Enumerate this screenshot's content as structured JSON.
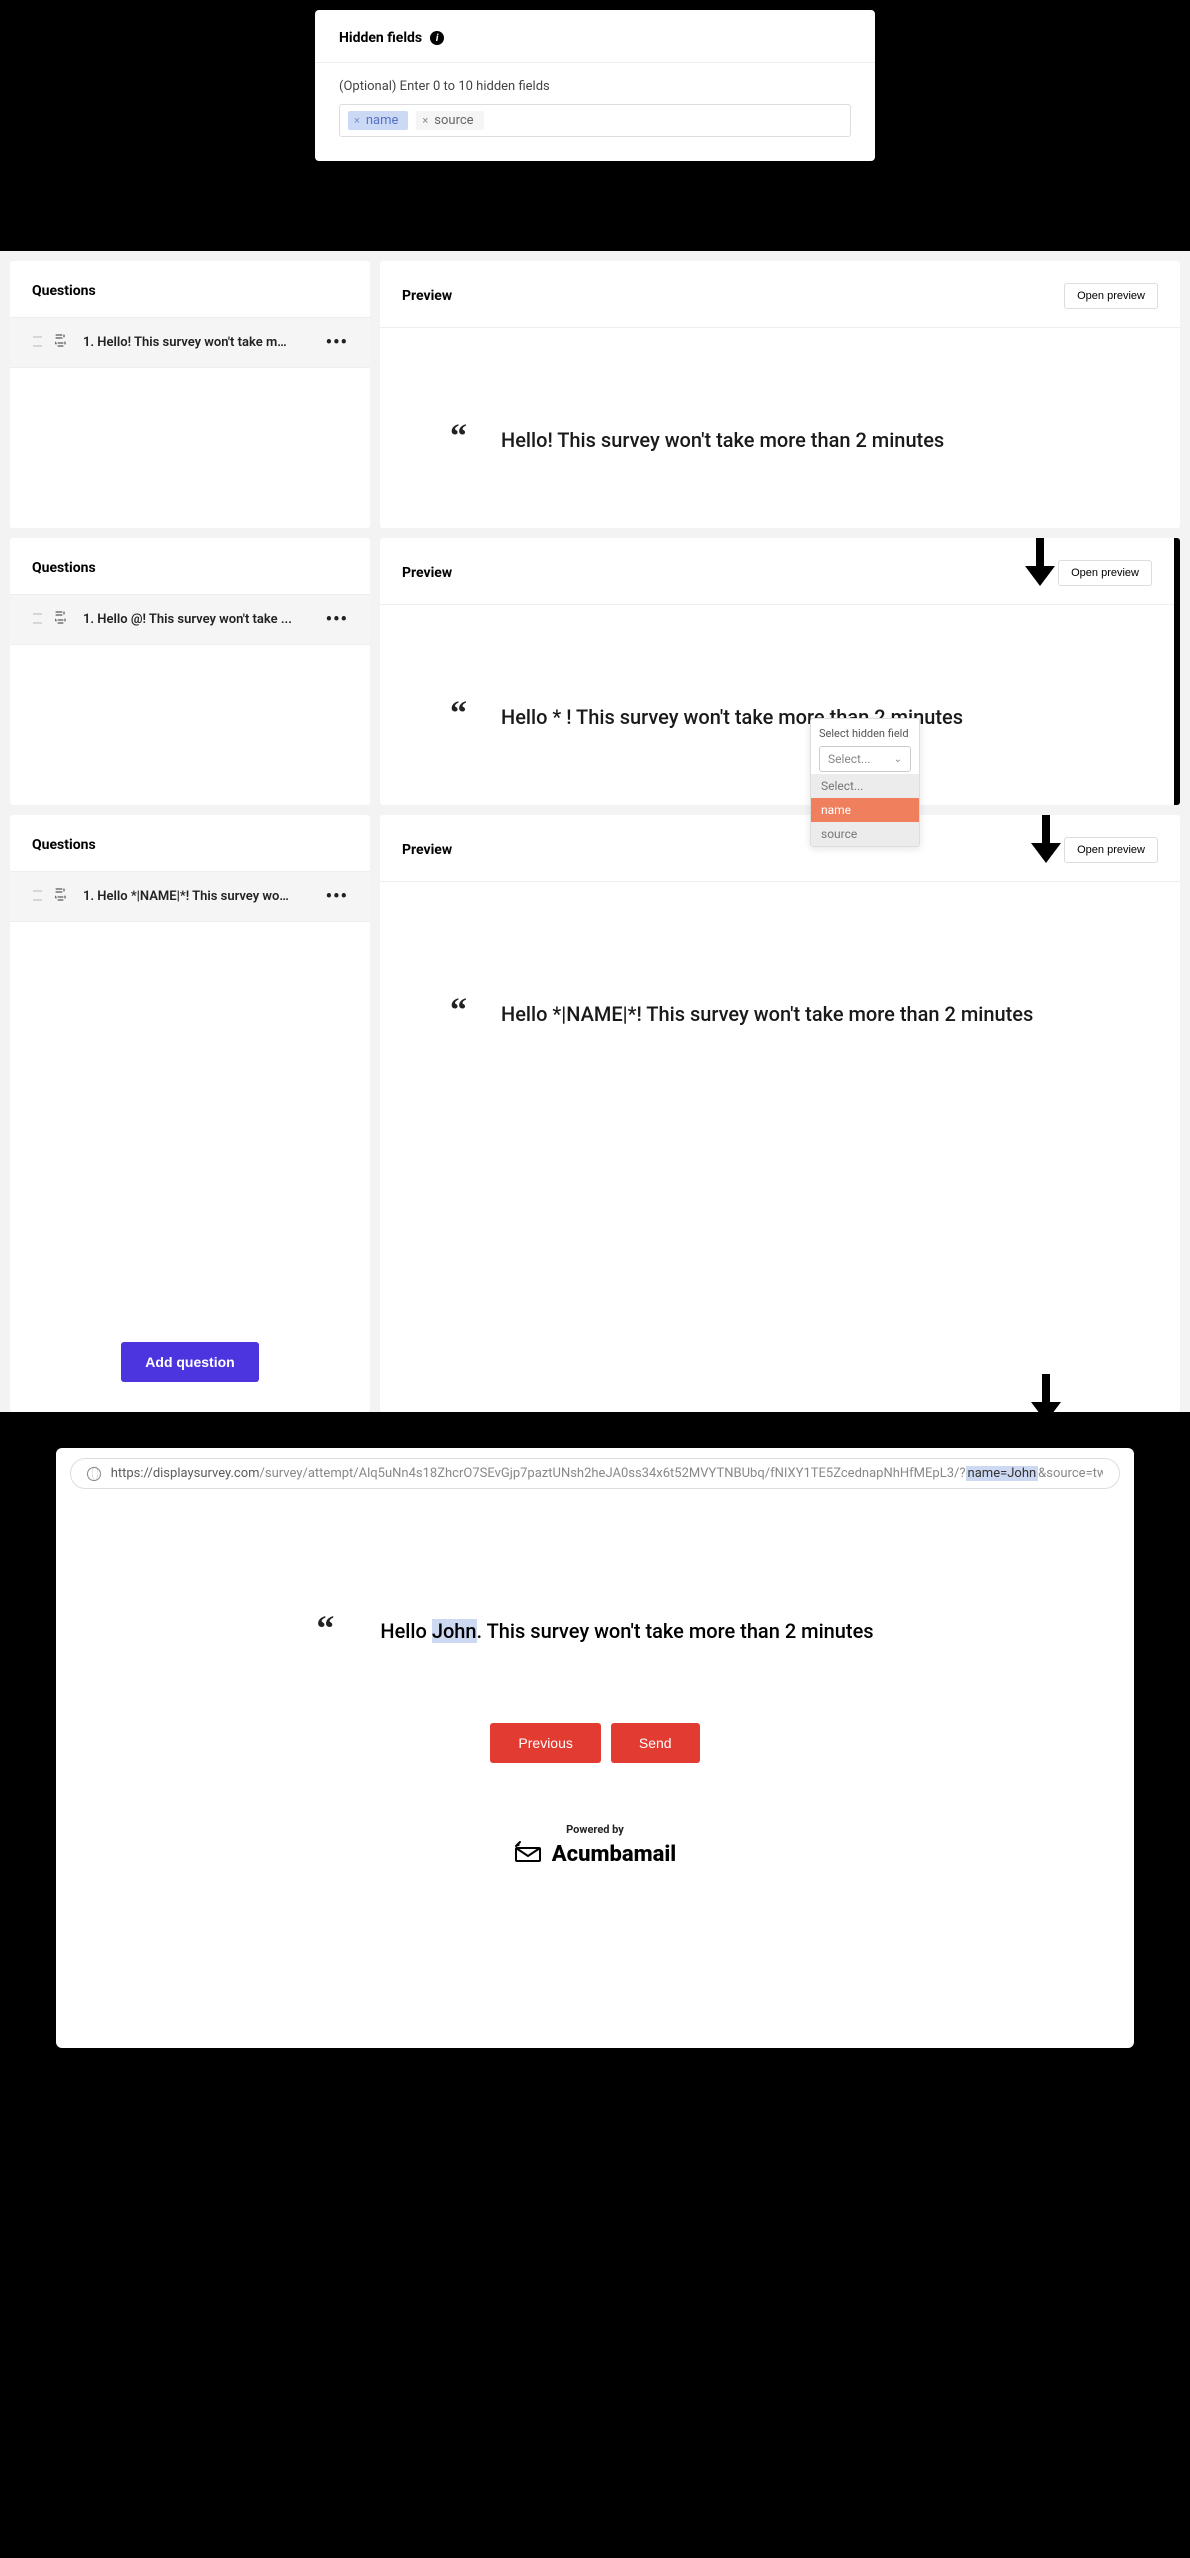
{
  "hidden_fields": {
    "title": "Hidden fields",
    "hint": "(Optional) Enter 0 to 10 hidden fields",
    "tags": {
      "name": "name",
      "source": "source"
    }
  },
  "panels": {
    "questions_title": "Questions",
    "preview_title": "Preview",
    "open_preview": "Open preview",
    "add_question": "Add question"
  },
  "step1": {
    "q_item": "1. Hello! This survey won't take mo...",
    "preview": "Hello! This survey won't take more than 2 minutes"
  },
  "step2": {
    "q_item": "1. Hello @! This survey won't take ...",
    "preview": "Hello  *  ! This survey won't take more than 2 minutes",
    "popup": {
      "header": "Select hidden field",
      "placeholder": "Select...",
      "options": {
        "select": "Select...",
        "name": "name",
        "source": "source"
      }
    }
  },
  "step3": {
    "q_item": "1. Hello *|NAME|*! This survey won'...",
    "preview": "Hello *|NAME|*! This survey won't take more than 2 minutes"
  },
  "final": {
    "url": {
      "host": "https://displaysurvey.com",
      "path": "/survey/attempt/Alq5uNn4s18ZhcrO7SEvGjp7paztUNsh2heJA0ss34x6t52MVYTNBUbq/fNIXY1TE5ZcednapNhHfMEpL3/?",
      "highlighted": "name=John",
      "rest": "&source=twitter"
    },
    "greeting_pre": "Hello ",
    "greeting_name": "John",
    "greeting_post": ". This survey won't take more than 2 minutes",
    "previous": "Previous",
    "send": "Send",
    "powered_by": "Powered by",
    "brand": "Acumbamail"
  }
}
